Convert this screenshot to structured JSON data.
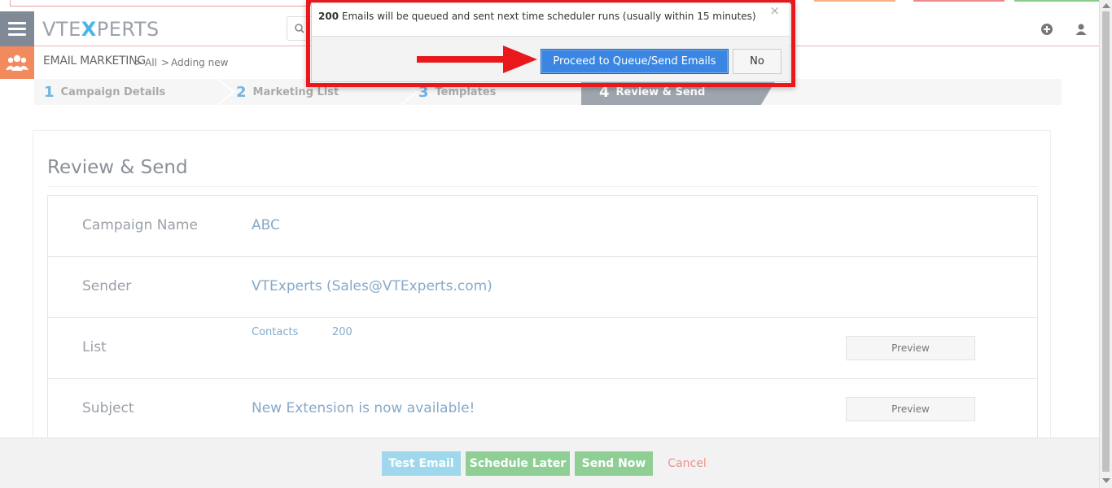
{
  "header": {
    "logo_prefix": "VTE",
    "logo_x": "X",
    "logo_suffix": "PERTS",
    "icons": [
      "menu-icon",
      "search-icon",
      "add-icon",
      "user-icon"
    ]
  },
  "module": {
    "name": "EMAIL MARKETING",
    "breadcrumb": [
      ">",
      "All",
      ">",
      "Adding new"
    ]
  },
  "steps": [
    {
      "num": "1",
      "label": "Campaign Details"
    },
    {
      "num": "2",
      "label": "Marketing List"
    },
    {
      "num": "3",
      "label": "Templates"
    },
    {
      "num": "4",
      "label": "Review & Send"
    }
  ],
  "panel": {
    "title": "Review & Send",
    "rows": [
      {
        "label": "Campaign Name",
        "value": "ABC"
      },
      {
        "label": "Sender",
        "value": "VTExperts (Sales@VTExperts.com)"
      },
      {
        "label": "List",
        "sub_name": "Contacts",
        "sub_count": "200",
        "button": "Preview"
      },
      {
        "label": "Subject",
        "value": "New Extension is now available!",
        "button": "Preview"
      }
    ]
  },
  "footer": {
    "test_email": "Test Email",
    "schedule_later": "Schedule Later",
    "send_now": "Send Now",
    "cancel": "Cancel"
  },
  "dialog": {
    "count": "200",
    "message": " Emails will be queued and sent next time scheduler runs (usually within 15 minutes)",
    "close": "×",
    "proceed": "Proceed to Queue/Send Emails",
    "no": "No"
  },
  "colors": {
    "accent_blue": "#3a86e2",
    "highlight_red": "#e8181c",
    "module_orange": "#f28a5e",
    "send_green": "#8fcf96",
    "test_blue": "#9fd7ec"
  }
}
